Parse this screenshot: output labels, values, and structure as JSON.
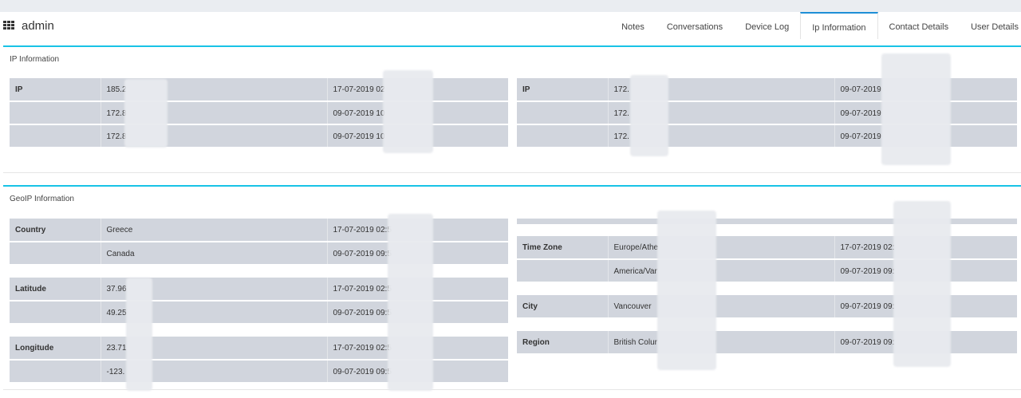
{
  "app": {
    "title": "admin"
  },
  "tabs": [
    {
      "label": "Notes",
      "active": false
    },
    {
      "label": "Conversations",
      "active": false
    },
    {
      "label": "Device Log",
      "active": false
    },
    {
      "label": "Ip Information",
      "active": true
    },
    {
      "label": "Contact Details",
      "active": false
    },
    {
      "label": "User Details",
      "active": false
    }
  ],
  "ip_panel": {
    "title": "IP Information",
    "left": {
      "label": "IP",
      "rows": [
        {
          "value": "185.2",
          "date": "17-07-2019 02"
        },
        {
          "value": "172.8",
          "date": "09-07-2019 10"
        },
        {
          "value": "172.8",
          "date": "09-07-2019 10"
        }
      ]
    },
    "right": {
      "label": "IP",
      "rows": [
        {
          "value": "172.",
          "date": "09-07-2019"
        },
        {
          "value": "172.",
          "date": "09-07-2019"
        },
        {
          "value": "172.",
          "date": "09-07-2019"
        }
      ]
    }
  },
  "geo_panel": {
    "title": "GeoIP Information",
    "country": {
      "label": "Country",
      "rows": [
        {
          "value": "Greece",
          "date": "17-07-2019 02:5"
        },
        {
          "value": "Canada",
          "date": "09-07-2019 09:5"
        }
      ]
    },
    "latitude": {
      "label": "Latitude",
      "rows": [
        {
          "value": "37.96",
          "date": "17-07-2019 02:5"
        },
        {
          "value": "49.25",
          "date": "09-07-2019 09:5"
        }
      ]
    },
    "longitude": {
      "label": "Longitude",
      "rows": [
        {
          "value": "23.71",
          "date": "17-07-2019 02:5"
        },
        {
          "value": "-123.",
          "date": "09-07-2019 09:5"
        }
      ]
    },
    "timezone": {
      "label": "Time Zone",
      "rows": [
        {
          "value": "Europe/Athe",
          "date": "17-07-2019 02:"
        },
        {
          "value": "America/Var",
          "date": "09-07-2019 09:"
        }
      ]
    },
    "city": {
      "label": "City",
      "rows": [
        {
          "value": "Vancouver",
          "date": "09-07-2019 09:"
        }
      ]
    },
    "region": {
      "label": "Region",
      "rows": [
        {
          "value": "British Colur",
          "date": "09-07-2019 09:"
        }
      ]
    }
  }
}
